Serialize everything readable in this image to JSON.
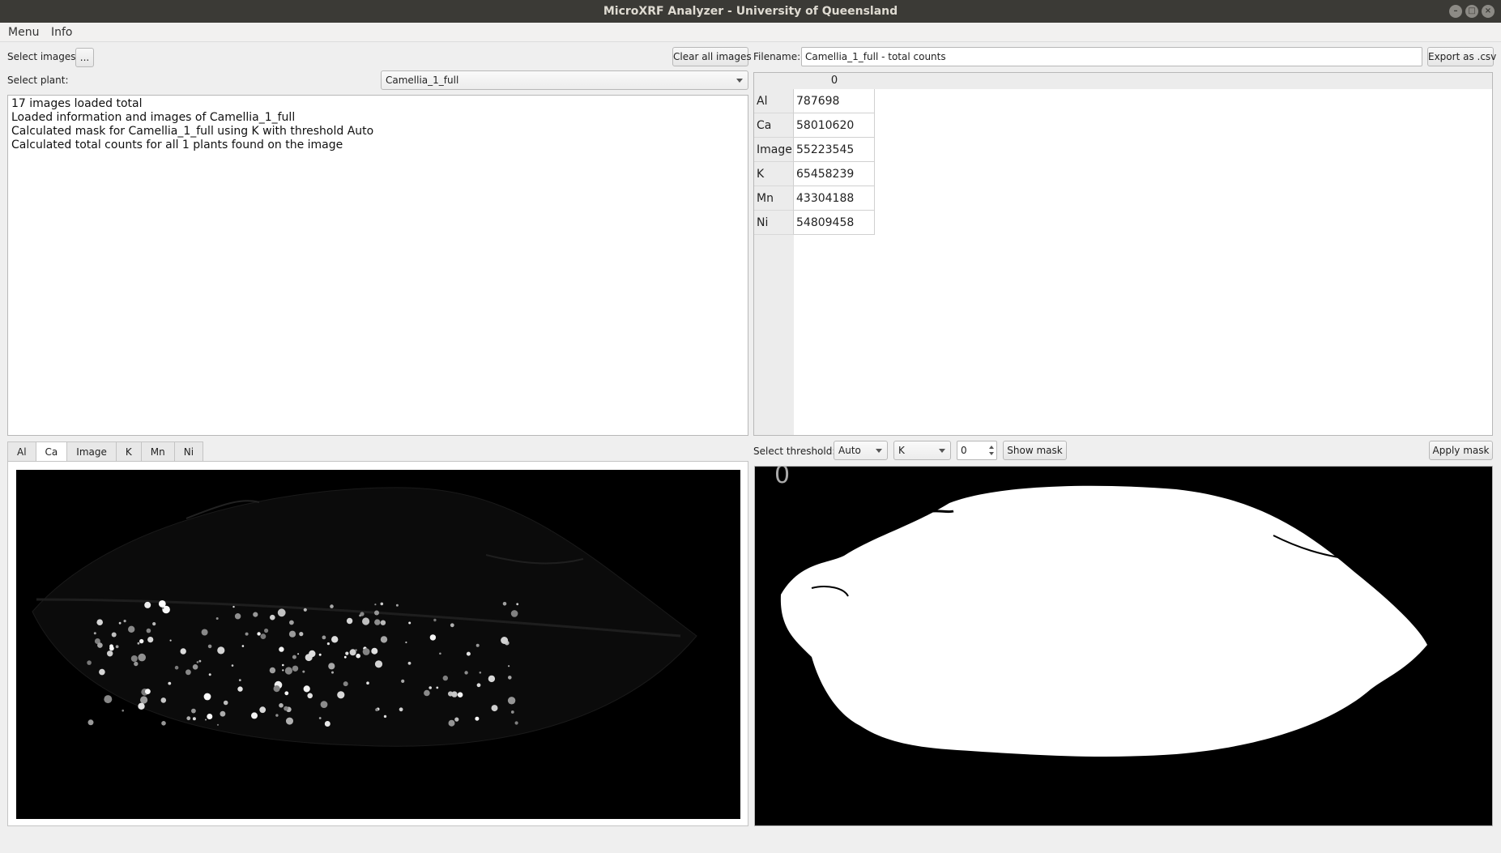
{
  "window": {
    "title": "MicroXRF Analyzer - University of Queensland"
  },
  "menu": {
    "items": [
      "Menu",
      "Info"
    ]
  },
  "left": {
    "select_images_label": "Select images:",
    "browse_label": "...",
    "clear_all_label": "Clear all images",
    "select_plant_label": "Select plant:",
    "plant_selected": "Camellia_1_full",
    "log_lines": [
      "17 images loaded total",
      "Loaded information and images of Camellia_1_full",
      "Calculated mask for Camellia_1_full using K with threshold Auto",
      "Calculated total counts for all 1 plants found on the image"
    ],
    "tabs": [
      "Al",
      "Ca",
      "Image",
      "K",
      "Mn",
      "Ni"
    ],
    "active_tab": "Ca"
  },
  "right": {
    "filename_label": "Filename:",
    "filename_value": "Camellia_1_full - total counts",
    "export_label": "Export as .csv",
    "table": {
      "column_header": "0",
      "rows": [
        {
          "label": "Al",
          "value": "787698"
        },
        {
          "label": "Ca",
          "value": "58010620"
        },
        {
          "label": "Image",
          "value": "55223545"
        },
        {
          "label": "K",
          "value": "65458239"
        },
        {
          "label": "Mn",
          "value": "43304188"
        },
        {
          "label": "Ni",
          "value": "54809458"
        }
      ]
    },
    "threshold_label": "Select threshold:",
    "threshold_mode": "Auto",
    "threshold_element": "K",
    "threshold_value": "0",
    "show_mask_label": "Show mask",
    "apply_mask_label": "Apply mask",
    "mask_corner_glyph": "0"
  }
}
